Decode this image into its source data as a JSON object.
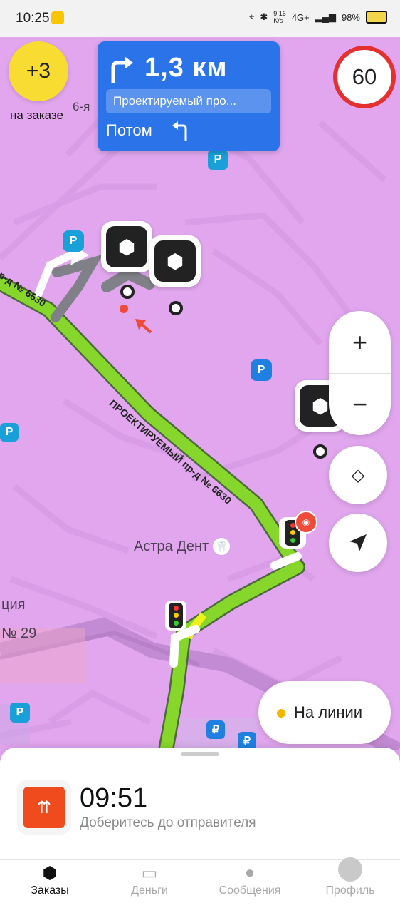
{
  "status_bar": {
    "time": "10:25",
    "network_speed_value": "9.16",
    "network_speed_unit": "K/s",
    "network_type": "4G+",
    "battery_percent": "98%"
  },
  "order_badge": {
    "value": "+3",
    "caption": "на заказе"
  },
  "navigation_card": {
    "distance": "1,3 км",
    "street": "Проектируемый про...",
    "next_label": "Потом"
  },
  "speed_limit": {
    "value": "60"
  },
  "map": {
    "street_labels": [
      "ПРОЕКТИРУЕМЫЙ пр-д № 6630",
      "р-д № 6630",
      "6-я",
      "№ 29",
      "ция"
    ],
    "poi_label": "Астра Дент"
  },
  "map_controls": {
    "zoom_in_icon": "plus-icon",
    "zoom_out_icon": "minus-icon",
    "layers_icon": "layers-icon",
    "locate_icon": "navigation-arrow-icon"
  },
  "online_status": {
    "label": "На линии",
    "dot_color": "#f3b600"
  },
  "bottom_sheet": {
    "time": "09:51",
    "subtitle": "Доберитесь до отправителя"
  },
  "tabs": [
    {
      "label": "Заказы",
      "icon": "box-icon"
    },
    {
      "label": "Деньги",
      "icon": "wallet-icon"
    },
    {
      "label": "Сообщения",
      "icon": "chat-icon"
    },
    {
      "label": "Профиль",
      "icon": "avatar"
    }
  ],
  "colors": {
    "map_bg": "#e1a6ee",
    "route": "#86d62b",
    "nav_card": "#2b73e8",
    "badge": "#f8dc32",
    "speed_border": "#e53030"
  }
}
